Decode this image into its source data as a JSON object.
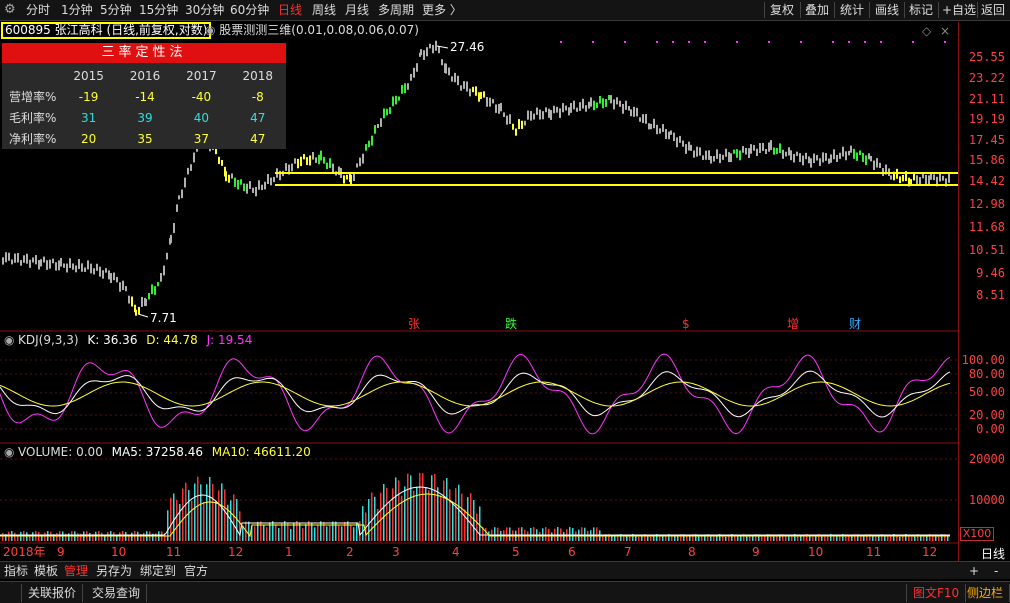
{
  "toolbar": {
    "periods": [
      "分时",
      "1分钟",
      "5分钟",
      "15分钟",
      "30分钟",
      "60分钟",
      "日线",
      "周线",
      "月线",
      "多周期",
      "更多 〉"
    ],
    "active_period": "日线",
    "right_buttons": [
      "复权",
      "叠加",
      "统计",
      "画线",
      "标记",
      "+自选",
      "返回"
    ]
  },
  "stock": {
    "title": "600895 张江高科 (日线,前复权,对数)",
    "indicator": "股票测测三维(0.01,0.08,0.06,0.07)"
  },
  "panel": {
    "title": "三率定性法",
    "years": [
      "2015",
      "2016",
      "2017",
      "2018"
    ],
    "rows": [
      {
        "label": "营增率%",
        "values": [
          "-19",
          "-14",
          "-40",
          "-8"
        ]
      },
      {
        "label": "毛利率%",
        "values": [
          "31",
          "39",
          "40",
          "47"
        ]
      },
      {
        "label": "净利率%",
        "values": [
          "20",
          "35",
          "37",
          "47"
        ]
      }
    ]
  },
  "price_axis": [
    "25.55",
    "23.22",
    "21.11",
    "19.19",
    "17.45",
    "15.86",
    "14.42",
    "12.98",
    "11.68",
    "10.51",
    "9.46",
    "8.51"
  ],
  "annotations": {
    "high": "27.46",
    "low": "7.71"
  },
  "markers": [
    "张",
    "跌",
    "$",
    "增",
    "财"
  ],
  "kdj": {
    "name": "KDJ(9,3,3)",
    "k": "K: 36.36",
    "d": "D: 44.78",
    "j": "J: 19.54",
    "axis": [
      "100.00",
      "80.00",
      "50.00",
      "20.00",
      "0.00"
    ]
  },
  "volume": {
    "name": "VOLUME: 0.00",
    "ma5": "MA5: 37258.46",
    "ma10": "MA10: 46611.20",
    "axis": [
      "20000",
      "10000"
    ],
    "unit": "X100"
  },
  "dates": [
    "2018年",
    "9",
    "10",
    "11",
    "12",
    "1",
    "2",
    "3",
    "4",
    "5",
    "6",
    "7",
    "8",
    "9",
    "10",
    "11",
    "12"
  ],
  "right_tag": "日线",
  "bottom_tabs": [
    "指标",
    "模板",
    "管理",
    "另存为",
    "绑定到",
    "官方"
  ],
  "active_tab": "管理",
  "bottom_right": [
    "+",
    "-"
  ],
  "footer": {
    "left": [
      "关联报价",
      "交易查询"
    ],
    "right": [
      "图文F10",
      "侧边栏"
    ]
  },
  "colors": {
    "up": "#ff3030",
    "down": "#33dddd",
    "k": "#ffffff",
    "d": "#ffff33",
    "j": "#ff33ff",
    "support": "#ffff00"
  }
}
